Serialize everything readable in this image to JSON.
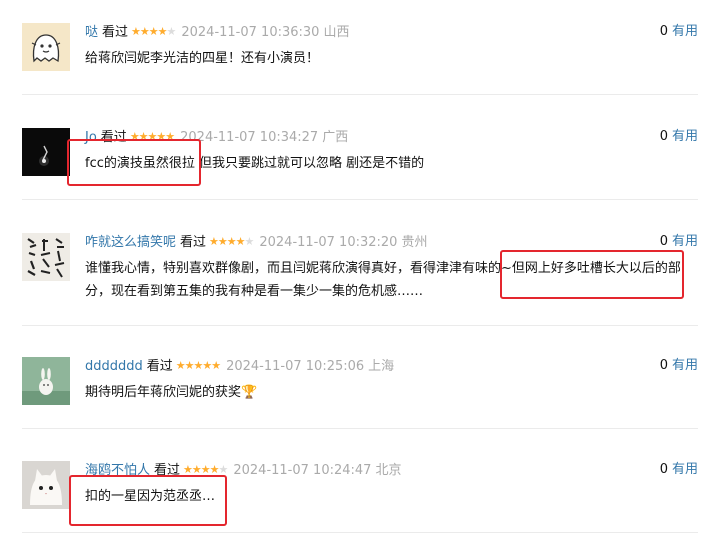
{
  "comments": [
    {
      "username": "哒",
      "watched_label": "看过",
      "rating": 4,
      "time": "2024-11-07 10:36:30",
      "location": "山西",
      "votes": "0",
      "useful_label": "有用",
      "content": "给蒋欣闫妮李光洁的四星！还有小演员！",
      "avatar": "ghost-doodle"
    },
    {
      "username": "Jo",
      "watched_label": "看过",
      "rating": 5,
      "time": "2024-11-07 10:34:27",
      "location": "广西",
      "votes": "0",
      "useful_label": "有用",
      "content": "fcc的演技虽然很拉 但我只要跳过就可以忽略 剧还是不错的",
      "avatar": "dark-light"
    },
    {
      "username": "咋就这么搞笑呢",
      "watched_label": "看过",
      "rating": 4,
      "time": "2024-11-07 10:32:20",
      "location": "贵州",
      "votes": "0",
      "useful_label": "有用",
      "content": "谁懂我心情，特别喜欢群像剧，而且闫妮蒋欣演得真好，看得津津有味的~但网上好多吐槽长大以后的部分，现在看到第五集的我有种是看一集少一集的危机感……",
      "avatar": "calligraphy"
    },
    {
      "username": "ddddddd",
      "watched_label": "看过",
      "rating": 5,
      "time": "2024-11-07 10:25:06",
      "location": "上海",
      "votes": "0",
      "useful_label": "有用",
      "content": "期待明后年蒋欣闫妮的获奖🏆",
      "avatar": "green-rabbit"
    },
    {
      "username": "海鸥不怕人",
      "watched_label": "看过",
      "rating": 4,
      "time": "2024-11-07 10:24:47",
      "location": "北京",
      "votes": "0",
      "useful_label": "有用",
      "content": "扣的一星因为范丞丞…",
      "avatar": "white-cat"
    }
  ],
  "colors": {
    "link": "#3377aa",
    "star": "#ffac2d",
    "meta": "#aaaaaa",
    "highlight": "#e4262e"
  }
}
